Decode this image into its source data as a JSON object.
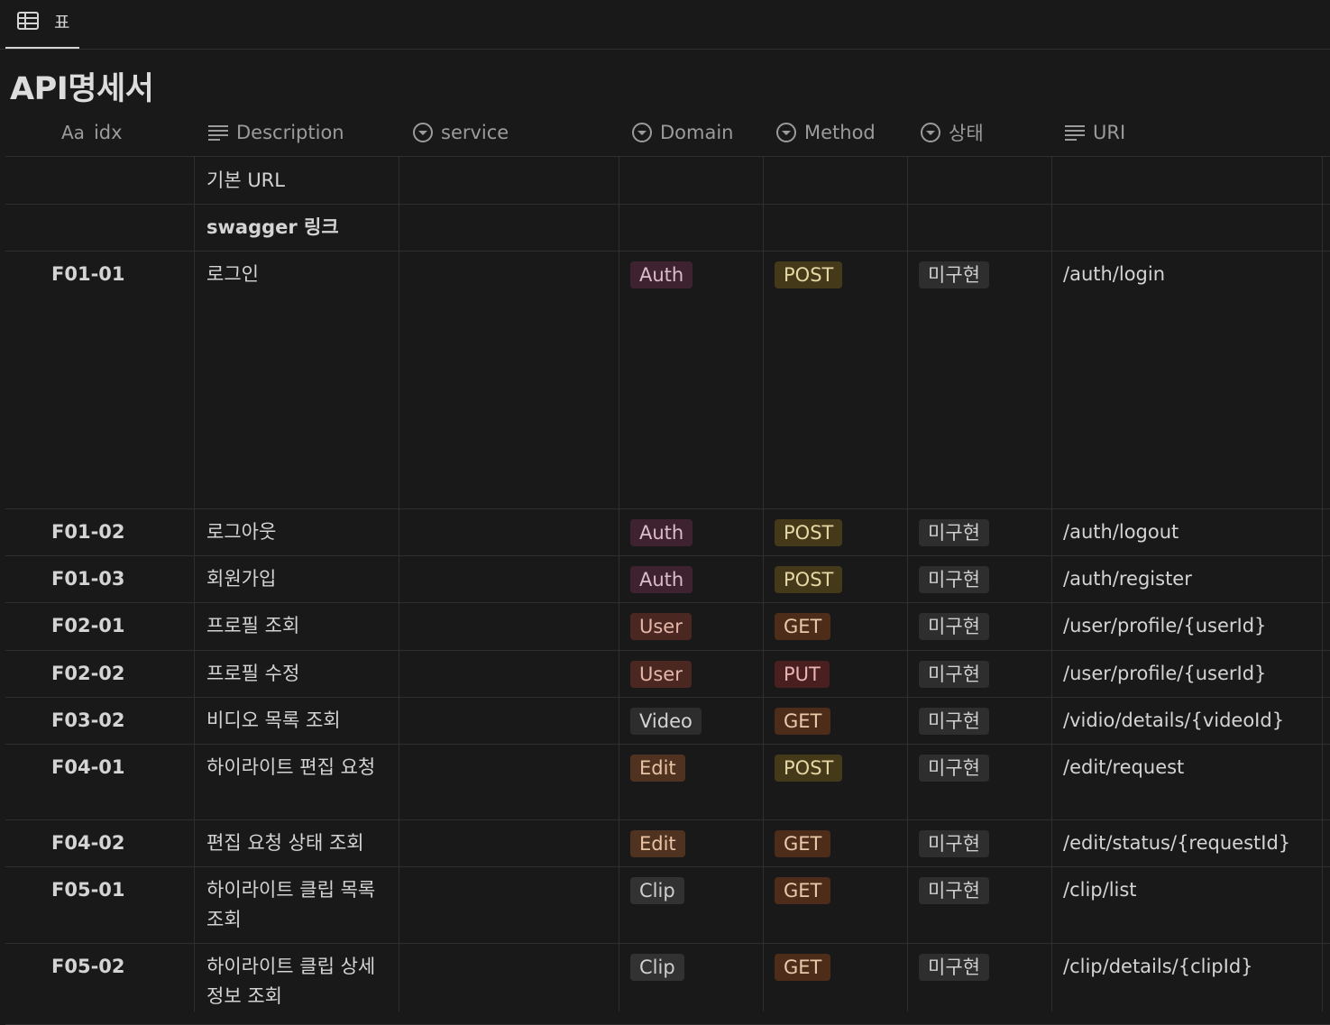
{
  "tab": {
    "icon": "table-icon",
    "label": "표"
  },
  "title": "API명세서",
  "columns": {
    "idx": {
      "prefix": "Aa",
      "label": "idx"
    },
    "description": "Description",
    "service": "service",
    "domain": "Domain",
    "method": "Method",
    "status": "상태",
    "uri": "URI"
  },
  "tag_colors": {
    "Auth": {
      "bg": "#3e2230",
      "fg": "#dcbccb"
    },
    "User": {
      "bg": "#4a2720",
      "fg": "#e5b7a8"
    },
    "Video": {
      "bg": "#2d2d2d",
      "fg": "#d4d4d4"
    },
    "Edit": {
      "bg": "#4f3220",
      "fg": "#e8c4a4"
    },
    "Clip": {
      "bg": "#323232",
      "fg": "#cfcfcf"
    },
    "POST": {
      "bg": "#443a1a",
      "fg": "#e6d7a5"
    },
    "GET": {
      "bg": "#4d2d1a",
      "fg": "#ebc8ab"
    },
    "PUT": {
      "bg": "#4a1f1f",
      "fg": "#e8b4b4"
    },
    "미구현": {
      "bg": "#2e2e2e",
      "fg": "#cfcfcf"
    }
  },
  "rows": [
    {
      "idx": "",
      "description": "기본 URL",
      "desc_bold": false,
      "domain": "",
      "method": "",
      "status": "",
      "uri": ""
    },
    {
      "idx": "",
      "description": "swagger 링크",
      "desc_bold": true,
      "domain": "",
      "method": "",
      "status": "",
      "uri": ""
    },
    {
      "idx": "F01-01",
      "description": "로그인",
      "domain": "Auth",
      "method": "POST",
      "status": "미구현",
      "uri": "/auth/login"
    },
    {
      "idx": "F01-02",
      "description": "로그아웃",
      "domain": "Auth",
      "method": "POST",
      "status": "미구현",
      "uri": "/auth/logout"
    },
    {
      "idx": "F01-03",
      "description": "회원가입",
      "domain": "Auth",
      "method": "POST",
      "status": "미구현",
      "uri": "/auth/register"
    },
    {
      "idx": "F02-01",
      "description": "프로필 조회",
      "domain": "User",
      "method": "GET",
      "status": "미구현",
      "uri": "/user/profile/{userId}"
    },
    {
      "idx": "F02-02",
      "description": "프로필 수정",
      "domain": "User",
      "method": "PUT",
      "status": "미구현",
      "uri": "/user/profile/{userId}"
    },
    {
      "idx": "F03-02",
      "description": "비디오 목록 조회",
      "domain": "Video",
      "method": "GET",
      "status": "미구현",
      "uri": "/vidio/details/{videoId}"
    },
    {
      "idx": "F04-01",
      "description": "하이라이트 편집 요청",
      "domain": "Edit",
      "method": "POST",
      "status": "미구현",
      "uri": "/edit/request"
    },
    {
      "idx": "F04-02",
      "description": "편집 요청 상태 조회",
      "domain": "Edit",
      "method": "GET",
      "status": "미구현",
      "uri": "/edit/status/{requestId}"
    },
    {
      "idx": "F05-01",
      "description": "하이라이트 클립 목록 조회",
      "domain": "Clip",
      "method": "GET",
      "status": "미구현",
      "uri": "/clip/list"
    },
    {
      "idx": "F05-02",
      "description": "하이라이트 클립 상세 정보 조회",
      "domain": "Clip",
      "method": "GET",
      "status": "미구현",
      "uri": "/clip/details/{clipId}"
    }
  ]
}
